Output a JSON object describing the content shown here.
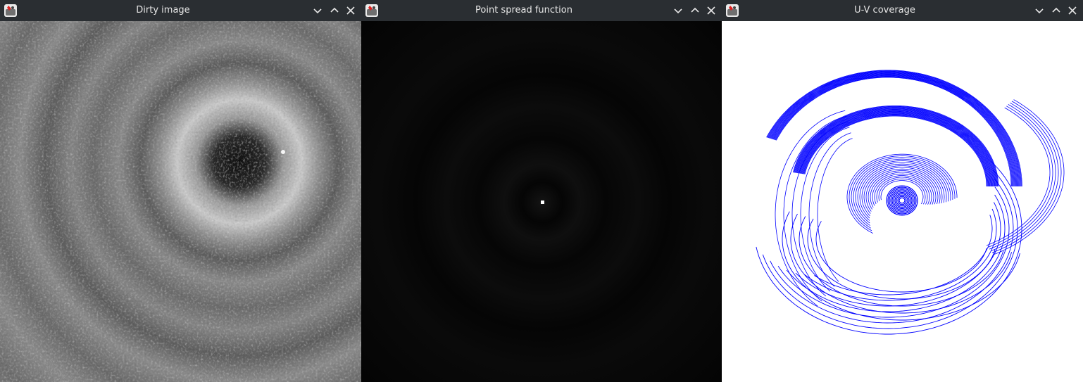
{
  "windows": [
    {
      "title": "Dirty image",
      "icon": "java-app-icon",
      "buttons": [
        "minimize-icon",
        "maximize-icon",
        "close-icon"
      ],
      "content": "grayscale dirty image with concentric ring structure"
    },
    {
      "title": "Point spread function",
      "icon": "java-app-icon",
      "buttons": [
        "minimize-icon",
        "maximize-icon",
        "close-icon"
      ],
      "content": "black field with bright central point"
    },
    {
      "title": "U-V coverage",
      "icon": "java-app-icon",
      "buttons": [
        "minimize-icon",
        "maximize-icon",
        "close-icon"
      ],
      "content": "blue elliptical uv tracks on white"
    }
  ],
  "colors": {
    "titlebar": "#2a2e32",
    "title_text": "#e6e6e6",
    "uv_tracks": "#0000ff",
    "uv_background": "#ffffff",
    "psf_background": "#000000"
  }
}
